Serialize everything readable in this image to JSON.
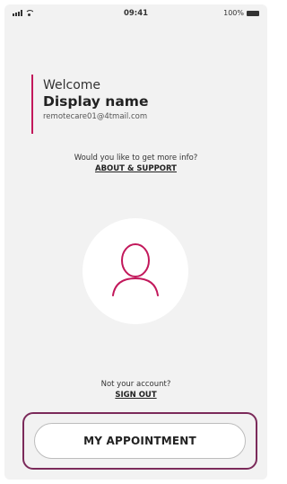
{
  "status_bar": {
    "time": "09:41",
    "battery_text": "100%",
    "icons": [
      "signal-icon",
      "wifi-icon",
      "battery-icon"
    ]
  },
  "welcome": {
    "title": "Welcome",
    "display_name": "Display name",
    "email": "remotecare01@4tmail.com"
  },
  "info": {
    "prompt": "Would you like to get more info?",
    "link_label": "ABOUT & SUPPORT"
  },
  "avatar": {
    "icon": "user-avatar-icon"
  },
  "account": {
    "prompt": "Not your account?",
    "signout_label": "SIGN OUT"
  },
  "appointment": {
    "button_label": "MY APPOINTMENT"
  },
  "colors": {
    "accent": "#c2185b",
    "highlight_outline": "#7b2a5a",
    "background": "#f2f2f2"
  }
}
